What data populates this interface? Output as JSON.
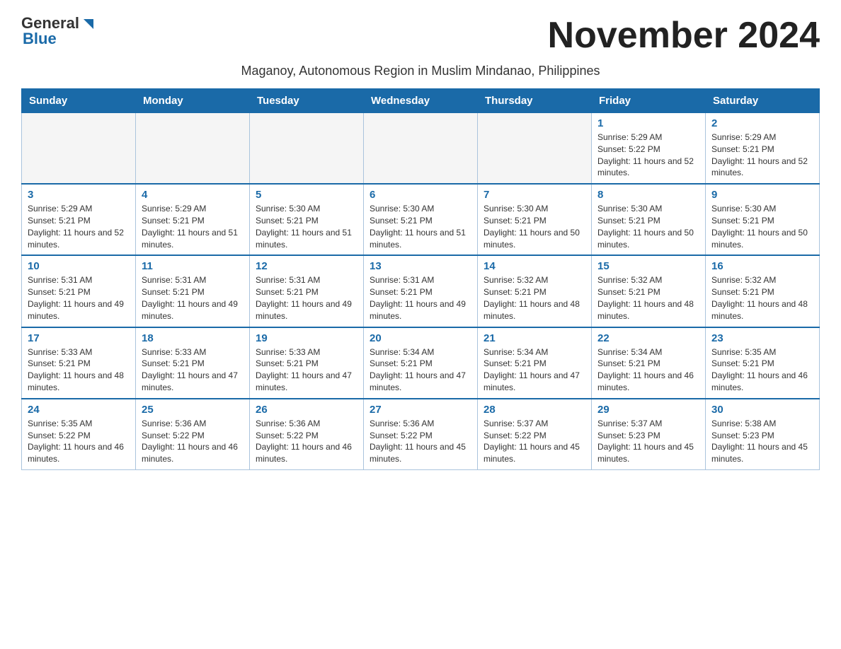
{
  "header": {
    "logo_general": "General",
    "logo_blue": "Blue",
    "month_title": "November 2024",
    "subtitle": "Maganoy, Autonomous Region in Muslim Mindanao, Philippines"
  },
  "weekdays": [
    "Sunday",
    "Monday",
    "Tuesday",
    "Wednesday",
    "Thursday",
    "Friday",
    "Saturday"
  ],
  "weeks": [
    [
      {
        "day": "",
        "info": ""
      },
      {
        "day": "",
        "info": ""
      },
      {
        "day": "",
        "info": ""
      },
      {
        "day": "",
        "info": ""
      },
      {
        "day": "",
        "info": ""
      },
      {
        "day": "1",
        "info": "Sunrise: 5:29 AM\nSunset: 5:22 PM\nDaylight: 11 hours and 52 minutes."
      },
      {
        "day": "2",
        "info": "Sunrise: 5:29 AM\nSunset: 5:21 PM\nDaylight: 11 hours and 52 minutes."
      }
    ],
    [
      {
        "day": "3",
        "info": "Sunrise: 5:29 AM\nSunset: 5:21 PM\nDaylight: 11 hours and 52 minutes."
      },
      {
        "day": "4",
        "info": "Sunrise: 5:29 AM\nSunset: 5:21 PM\nDaylight: 11 hours and 51 minutes."
      },
      {
        "day": "5",
        "info": "Sunrise: 5:30 AM\nSunset: 5:21 PM\nDaylight: 11 hours and 51 minutes."
      },
      {
        "day": "6",
        "info": "Sunrise: 5:30 AM\nSunset: 5:21 PM\nDaylight: 11 hours and 51 minutes."
      },
      {
        "day": "7",
        "info": "Sunrise: 5:30 AM\nSunset: 5:21 PM\nDaylight: 11 hours and 50 minutes."
      },
      {
        "day": "8",
        "info": "Sunrise: 5:30 AM\nSunset: 5:21 PM\nDaylight: 11 hours and 50 minutes."
      },
      {
        "day": "9",
        "info": "Sunrise: 5:30 AM\nSunset: 5:21 PM\nDaylight: 11 hours and 50 minutes."
      }
    ],
    [
      {
        "day": "10",
        "info": "Sunrise: 5:31 AM\nSunset: 5:21 PM\nDaylight: 11 hours and 49 minutes."
      },
      {
        "day": "11",
        "info": "Sunrise: 5:31 AM\nSunset: 5:21 PM\nDaylight: 11 hours and 49 minutes."
      },
      {
        "day": "12",
        "info": "Sunrise: 5:31 AM\nSunset: 5:21 PM\nDaylight: 11 hours and 49 minutes."
      },
      {
        "day": "13",
        "info": "Sunrise: 5:31 AM\nSunset: 5:21 PM\nDaylight: 11 hours and 49 minutes."
      },
      {
        "day": "14",
        "info": "Sunrise: 5:32 AM\nSunset: 5:21 PM\nDaylight: 11 hours and 48 minutes."
      },
      {
        "day": "15",
        "info": "Sunrise: 5:32 AM\nSunset: 5:21 PM\nDaylight: 11 hours and 48 minutes."
      },
      {
        "day": "16",
        "info": "Sunrise: 5:32 AM\nSunset: 5:21 PM\nDaylight: 11 hours and 48 minutes."
      }
    ],
    [
      {
        "day": "17",
        "info": "Sunrise: 5:33 AM\nSunset: 5:21 PM\nDaylight: 11 hours and 48 minutes."
      },
      {
        "day": "18",
        "info": "Sunrise: 5:33 AM\nSunset: 5:21 PM\nDaylight: 11 hours and 47 minutes."
      },
      {
        "day": "19",
        "info": "Sunrise: 5:33 AM\nSunset: 5:21 PM\nDaylight: 11 hours and 47 minutes."
      },
      {
        "day": "20",
        "info": "Sunrise: 5:34 AM\nSunset: 5:21 PM\nDaylight: 11 hours and 47 minutes."
      },
      {
        "day": "21",
        "info": "Sunrise: 5:34 AM\nSunset: 5:21 PM\nDaylight: 11 hours and 47 minutes."
      },
      {
        "day": "22",
        "info": "Sunrise: 5:34 AM\nSunset: 5:21 PM\nDaylight: 11 hours and 46 minutes."
      },
      {
        "day": "23",
        "info": "Sunrise: 5:35 AM\nSunset: 5:21 PM\nDaylight: 11 hours and 46 minutes."
      }
    ],
    [
      {
        "day": "24",
        "info": "Sunrise: 5:35 AM\nSunset: 5:22 PM\nDaylight: 11 hours and 46 minutes."
      },
      {
        "day": "25",
        "info": "Sunrise: 5:36 AM\nSunset: 5:22 PM\nDaylight: 11 hours and 46 minutes."
      },
      {
        "day": "26",
        "info": "Sunrise: 5:36 AM\nSunset: 5:22 PM\nDaylight: 11 hours and 46 minutes."
      },
      {
        "day": "27",
        "info": "Sunrise: 5:36 AM\nSunset: 5:22 PM\nDaylight: 11 hours and 45 minutes."
      },
      {
        "day": "28",
        "info": "Sunrise: 5:37 AM\nSunset: 5:22 PM\nDaylight: 11 hours and 45 minutes."
      },
      {
        "day": "29",
        "info": "Sunrise: 5:37 AM\nSunset: 5:23 PM\nDaylight: 11 hours and 45 minutes."
      },
      {
        "day": "30",
        "info": "Sunrise: 5:38 AM\nSunset: 5:23 PM\nDaylight: 11 hours and 45 minutes."
      }
    ]
  ]
}
